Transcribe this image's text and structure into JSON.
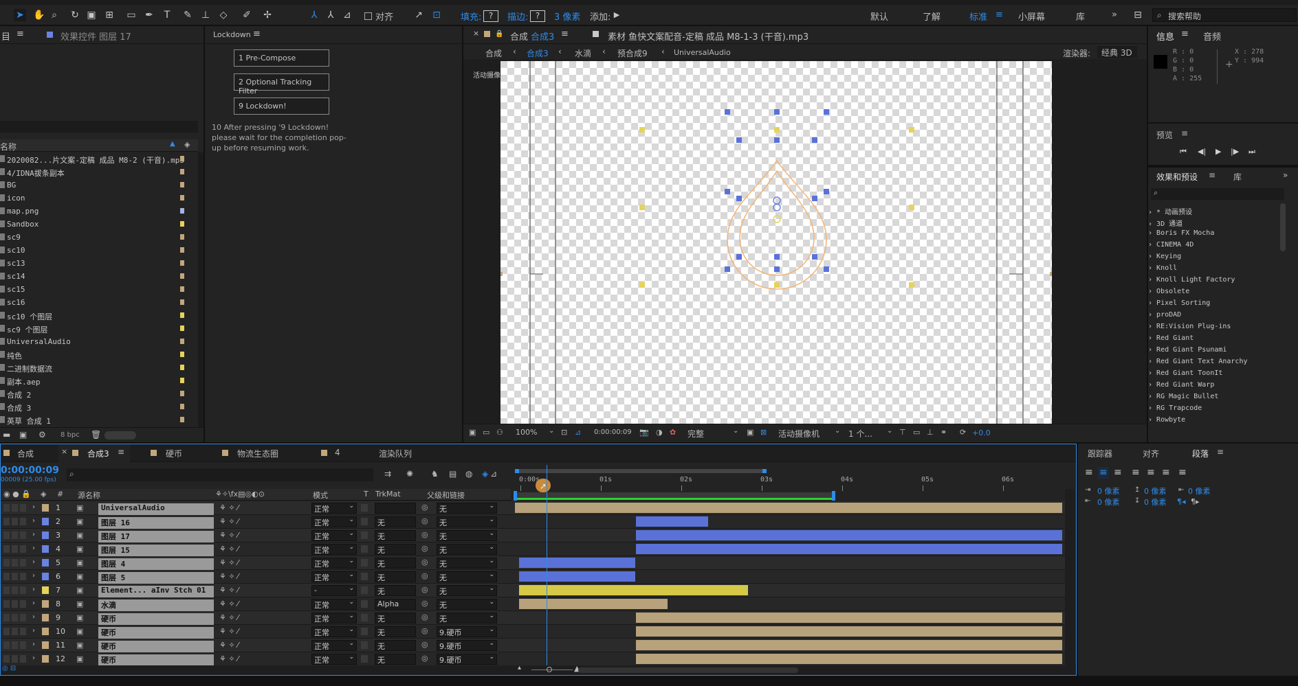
{
  "toolbar": {
    "align_label": "对齐",
    "fill_label": "填充:",
    "stroke_label": "描边:",
    "stroke_size": "3 像素",
    "add_label": "添加:",
    "workspaces": [
      "默认",
      "了解",
      "标准",
      "小屏幕",
      "库"
    ],
    "search_placeholder": "搜索帮助"
  },
  "project_panel": {
    "tab1": "目",
    "tab2": "效果控件 图层 17",
    "column_name": "名称",
    "bpc": "8 bpc",
    "items": [
      {
        "name": "2020082...片文案-定稿 成品 M8-2 (干音).mp3",
        "color": "#c2a77d"
      },
      {
        "name": "4/IDNA拔条副本",
        "color": "#c2a77d"
      },
      {
        "name": "BG",
        "color": "#c2a77d"
      },
      {
        "name": "icon",
        "color": "#c2a77d"
      },
      {
        "name": "map.png",
        "color": "#a7b2e0"
      },
      {
        "name": "Sandbox",
        "color": "#e5d35a"
      },
      {
        "name": "sc9",
        "color": "#c2a77d"
      },
      {
        "name": "sc10",
        "color": "#c2a77d"
      },
      {
        "name": "sc13",
        "color": "#c2a77d"
      },
      {
        "name": "sc14",
        "color": "#c2a77d"
      },
      {
        "name": "sc15",
        "color": "#c2a77d"
      },
      {
        "name": "sc16",
        "color": "#c2a77d"
      },
      {
        "name": "sc10 个图层",
        "color": "#e5d35a"
      },
      {
        "name": "sc9 个图层",
        "color": "#e5d35a"
      },
      {
        "name": "UniversalAudio",
        "color": "#c2a77d"
      },
      {
        "name": "纯色",
        "color": "#e5d35a"
      },
      {
        "name": "二进制数据流",
        "color": "#e5d35a"
      },
      {
        "name": "副本.aep",
        "color": "#e5d35a"
      },
      {
        "name": "合成 2",
        "color": "#c2a77d"
      },
      {
        "name": "合成 3",
        "color": "#c2a77d"
      },
      {
        "name": "英草 合成 1",
        "color": "#c2a77d"
      }
    ]
  },
  "lockdown": {
    "title": "Lockdown",
    "btn1": "1 Pre-Compose",
    "btn2": "2 Optional Tracking Filter",
    "btn3": "9 Lockdown!",
    "note": "10 After pressing '9 Lockdown! please wait for the completion pop-up before resuming work."
  },
  "composition": {
    "tab_comp_prefix": "合成",
    "tab_comp": "合成3",
    "tab_footage": "素材 鱼快文案配音-定稿 成品 M8-1-3 (干音).mp3",
    "breadcrumb": [
      "合成",
      "合成3",
      "水滴",
      "预合成9",
      "UniversalAudio"
    ],
    "renderer_label": "渲染器:",
    "renderer_value": "经典 3D",
    "camera_label": "活动摄像机",
    "zoom": "100%",
    "timecode": "0:00:00:09",
    "quality": "完整",
    "camera": "活动摄像机",
    "views": "1 个...",
    "exposure": "+0.0"
  },
  "info": {
    "tab1": "信息",
    "tab2": "音频",
    "r": "R : 0",
    "g": "G : 0",
    "b": "B : 0",
    "a": "A : 255",
    "x": "X : 278",
    "y": "Y : 994"
  },
  "preview": {
    "title": "预览"
  },
  "effects": {
    "tab1": "效果和预设",
    "tab2": "库",
    "items": [
      "* 动画预设",
      "3D 通道",
      "Boris FX Mocha",
      "CINEMA 4D",
      "Keying",
      "Knoll",
      "Knoll Light Factory",
      "Obsolete",
      "Pixel Sorting",
      "proDAD",
      "RE:Vision Plug-ins",
      "Red Giant",
      "Red Giant Psunami",
      "Red Giant Text Anarchy",
      "Red Giant ToonIt",
      "Red Giant Warp",
      "RG Magic Bullet",
      "RG Trapcode",
      "Rowbyte"
    ]
  },
  "right_bottom": {
    "tab1": "跟踪器",
    "tab2": "对齐",
    "tab3": "段落",
    "px": "0 像素"
  },
  "timeline": {
    "tabs": [
      "合成",
      "合成3",
      "硬币",
      "物流生态圈",
      "4",
      "渲染队列"
    ],
    "timecode": "0:00:00:09",
    "fps": "00009 (25.00 fps)",
    "col_source": "源名称",
    "col_mode": "模式",
    "col_t": "T",
    "col_trkmat": "TrkMat",
    "col_parent": "父级和链接",
    "ruler": [
      "0:00s",
      "01s",
      "02s",
      "03s",
      "04s",
      "05s",
      "06s"
    ],
    "layers": [
      {
        "num": "1",
        "name": "UniversalAudio",
        "color": "#c2a77d",
        "mode": "正常",
        "trk": "",
        "parent": "无",
        "bar_start": 0.0,
        "bar_end": 6.8,
        "bar_color": "#b7a27c"
      },
      {
        "num": "2",
        "name": "图层 16",
        "color": "#6a82e0",
        "mode": "正常",
        "trk": "无",
        "parent": "无",
        "bar_start": 1.5,
        "bar_end": 2.4,
        "bar_color": "#5a72d8"
      },
      {
        "num": "3",
        "name": "图层 17",
        "color": "#6a82e0",
        "mode": "正常",
        "trk": "无",
        "parent": "无",
        "bar_start": 1.5,
        "bar_end": 6.8,
        "bar_color": "#5a72d8"
      },
      {
        "num": "4",
        "name": "图层 15",
        "color": "#6a82e0",
        "mode": "正常",
        "trk": "无",
        "parent": "无",
        "bar_start": 1.5,
        "bar_end": 6.8,
        "bar_color": "#5a72d8"
      },
      {
        "num": "5",
        "name": "图层 4",
        "color": "#6a82e0",
        "mode": "正常",
        "trk": "无",
        "parent": "无",
        "bar_start": 0.05,
        "bar_end": 1.5,
        "bar_color": "#5a72d8"
      },
      {
        "num": "6",
        "name": "图层 5",
        "color": "#6a82e0",
        "mode": "正常",
        "trk": "无",
        "parent": "无",
        "bar_start": 0.05,
        "bar_end": 1.5,
        "bar_color": "#5a72d8"
      },
      {
        "num": "7",
        "name": "Element... aInv Stch 01",
        "color": "#e5d35a",
        "mode": "-",
        "trk": "无",
        "parent": "无",
        "bar_start": 0.05,
        "bar_end": 2.9,
        "bar_color": "#d6c948"
      },
      {
        "num": "8",
        "name": "水滴",
        "color": "#c2a77d",
        "mode": "正常",
        "trk": "Alpha",
        "parent": "无",
        "bar_start": 0.05,
        "bar_end": 1.9,
        "bar_color": "#b7a27c"
      },
      {
        "num": "9",
        "name": "硬币",
        "color": "#c2a77d",
        "mode": "正常",
        "trk": "无",
        "parent": "无",
        "bar_start": 1.5,
        "bar_end": 6.8,
        "bar_color": "#b7a27c"
      },
      {
        "num": "10",
        "name": "硬币",
        "color": "#c2a77d",
        "mode": "正常",
        "trk": "无",
        "parent": "9.硬币",
        "bar_start": 1.5,
        "bar_end": 6.8,
        "bar_color": "#b7a27c"
      },
      {
        "num": "11",
        "name": "硬币",
        "color": "#c2a77d",
        "mode": "正常",
        "trk": "无",
        "parent": "9.硬币",
        "bar_start": 1.5,
        "bar_end": 6.8,
        "bar_color": "#b7a27c"
      },
      {
        "num": "12",
        "name": "硬币",
        "color": "#c2a77d",
        "mode": "正常",
        "trk": "无",
        "parent": "9.硬币",
        "bar_start": 1.5,
        "bar_end": 6.8,
        "bar_color": "#b7a27c"
      }
    ]
  }
}
